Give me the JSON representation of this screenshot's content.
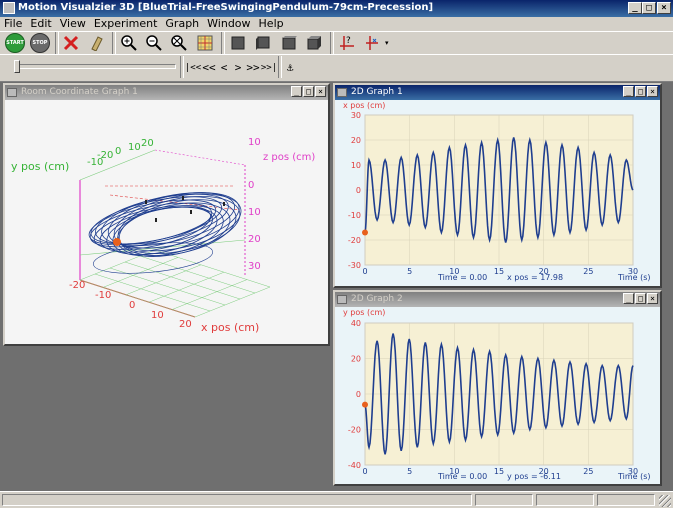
{
  "app": {
    "title": "Motion Visualzier 3D [BlueTrial-FreeSwingingPendulum-79cm-Precession]"
  },
  "menu": [
    "File",
    "Edit",
    "View",
    "Experiment",
    "Graph",
    "Window",
    "Help"
  ],
  "toolbar": {
    "start_label": "START",
    "stop_label": "STOP"
  },
  "nav": {
    "first": "|<<",
    "prev_fast": "<<",
    "prev": "<",
    "next": ">",
    "next_fast": ">>",
    "last": ">>|",
    "anchor": "⚓"
  },
  "windows": {
    "room": {
      "title": "Room Coordinate Graph 1",
      "y_label": "y pos (cm)",
      "x_label": "x pos (cm)",
      "z_label": "z pos (cm)",
      "y_ticks": [
        "-20",
        "-10",
        "0",
        "10",
        "20"
      ],
      "x_ticks": [
        "-20",
        "-10",
        "0",
        "10",
        "20"
      ],
      "z_ticks": [
        "10",
        "0",
        "10",
        "20",
        "30"
      ]
    },
    "graph1": {
      "title": "2D Graph 1",
      "ylabel": "x pos (cm)",
      "xlabel": "Time (s)",
      "y_ticks": [
        "30",
        "20",
        "10",
        "0",
        "-10",
        "-20",
        "-30"
      ],
      "x_ticks": [
        "0",
        "5",
        "10",
        "15",
        "20",
        "25",
        "30"
      ],
      "readout_time": "Time = 0.00",
      "readout_value": "x pos = 17.98"
    },
    "graph2": {
      "title": "2D Graph 2",
      "ylabel": "y pos (cm)",
      "xlabel": "Time (s)",
      "y_ticks": [
        "40",
        "20",
        "0",
        "-20",
        "-40"
      ],
      "x_ticks": [
        "0",
        "5",
        "10",
        "15",
        "20",
        "25",
        "30"
      ],
      "readout_time": "Time = 0.00",
      "readout_value": "y pos = -6.11"
    }
  },
  "colors": {
    "plot_bg": "#f6f0d4",
    "trace": "#1f3e8f",
    "axis_label": "#e03c3c",
    "marker": "#e8601c",
    "grid_green": "#36b336",
    "z_axis": "#e040c8"
  },
  "chart_data": [
    {
      "type": "line",
      "title": "2D Graph 1",
      "xlabel": "Time (s)",
      "ylabel": "x pos (cm)",
      "xlim": [
        0,
        30
      ],
      "ylim": [
        -30,
        30
      ],
      "series": [
        {
          "name": "x pos (cm)",
          "model": "damped-ish sine, period ~1.8 s",
          "points": [
            [
              0,
              -17
            ],
            [
              0.45,
              12
            ],
            [
              1.35,
              -12
            ],
            [
              2.25,
              12
            ],
            [
              3.15,
              -13
            ],
            [
              4.05,
              13
            ],
            [
              4.95,
              -14
            ],
            [
              5.85,
              14
            ],
            [
              6.75,
              -15
            ],
            [
              7.65,
              15
            ],
            [
              8.55,
              -17
            ],
            [
              9.45,
              17
            ],
            [
              10.35,
              -18
            ],
            [
              11.25,
              18
            ],
            [
              12.15,
              -19
            ],
            [
              13.05,
              19
            ],
            [
              13.95,
              -20
            ],
            [
              14.85,
              20
            ],
            [
              15.75,
              -21
            ],
            [
              16.65,
              21
            ],
            [
              17.55,
              -20
            ],
            [
              18.45,
              20
            ],
            [
              19.35,
              -19
            ],
            [
              20.25,
              19
            ],
            [
              21.15,
              -18
            ],
            [
              22.05,
              18
            ],
            [
              22.95,
              -17
            ],
            [
              23.85,
              17
            ],
            [
              24.75,
              -16
            ],
            [
              25.65,
              15
            ],
            [
              26.55,
              -14
            ],
            [
              27.45,
              14
            ],
            [
              28.35,
              -13
            ],
            [
              29.25,
              12
            ],
            [
              30,
              0
            ]
          ]
        }
      ]
    },
    {
      "type": "line",
      "title": "2D Graph 2",
      "xlabel": "Time (s)",
      "ylabel": "y pos (cm)",
      "xlim": [
        0,
        30
      ],
      "ylim": [
        -40,
        40
      ],
      "series": [
        {
          "name": "y pos (cm)",
          "points": [
            [
              0,
              -6
            ],
            [
              0.45,
              -30
            ],
            [
              1.35,
              30
            ],
            [
              2.25,
              -34
            ],
            [
              3.15,
              34
            ],
            [
              4.05,
              -32
            ],
            [
              4.95,
              31
            ],
            [
              5.85,
              -30
            ],
            [
              6.75,
              29
            ],
            [
              7.65,
              -28
            ],
            [
              8.55,
              28
            ],
            [
              9.45,
              -27
            ],
            [
              10.35,
              26
            ],
            [
              11.25,
              -26
            ],
            [
              12.15,
              25
            ],
            [
              13.05,
              -24
            ],
            [
              13.95,
              24
            ],
            [
              14.85,
              -23
            ],
            [
              15.75,
              22
            ],
            [
              16.65,
              -22
            ],
            [
              17.55,
              21
            ],
            [
              18.45,
              -20
            ],
            [
              19.35,
              20
            ],
            [
              20.25,
              -19
            ],
            [
              21.15,
              19
            ],
            [
              22.05,
              -18
            ],
            [
              22.95,
              18
            ],
            [
              23.85,
              -17
            ],
            [
              24.75,
              17
            ],
            [
              25.65,
              -16
            ],
            [
              26.55,
              16
            ],
            [
              27.45,
              -15
            ],
            [
              28.35,
              16
            ],
            [
              29.25,
              -14
            ],
            [
              30,
              16
            ]
          ]
        }
      ]
    }
  ]
}
